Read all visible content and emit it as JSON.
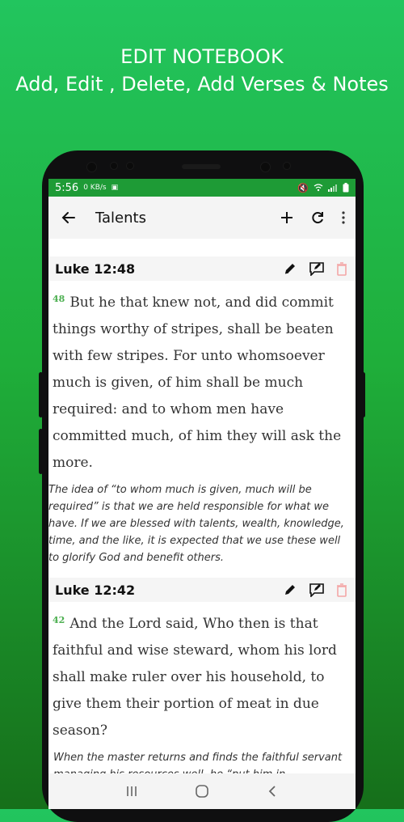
{
  "headline": {
    "line1": "EDIT NOTEBOOK",
    "line2": "Add, Edit , Delete,  Add Verses & Notes"
  },
  "status_bar": {
    "time": "5:56",
    "kbps": "0 KB/s"
  },
  "app_bar": {
    "title": "Talents"
  },
  "entries": [
    {
      "reference": "Luke 12:48",
      "verse_number": "48",
      "verse_text": "But he that knew not, and did commit things worthy of stripes, shall be beaten with few stripes. For unto whomsoever much is given, of him shall be much required: and to whom men have committed much, of him they will ask the more.",
      "note": "The idea of “to whom much is given, much will be required” is that we are held responsible for what we have. If we are blessed with talents, wealth, knowledge, time, and the like, it is expected that we use these well to glorify God and benefit others."
    },
    {
      "reference": "Luke 12:42",
      "verse_number": "42",
      "verse_text": "And the Lord said, Who then is that faithful and wise steward, whom his lord shall make ruler over his household, to give them their portion of meat in due season?",
      "note": "When the master returns and finds the faithful servant managing his resources well, he “put him in"
    }
  ],
  "colors": {
    "accent_green": "#1e9b36",
    "verse_number_green": "#4caf50",
    "delete_icon_pink": "#f3a6a6"
  },
  "icons": {
    "back": "arrow-left-icon",
    "add": "plus-icon",
    "refresh": "refresh-icon",
    "more": "more-vertical-icon",
    "edit": "pencil-icon",
    "edit_note": "edit-note-icon",
    "delete": "trash-icon"
  }
}
